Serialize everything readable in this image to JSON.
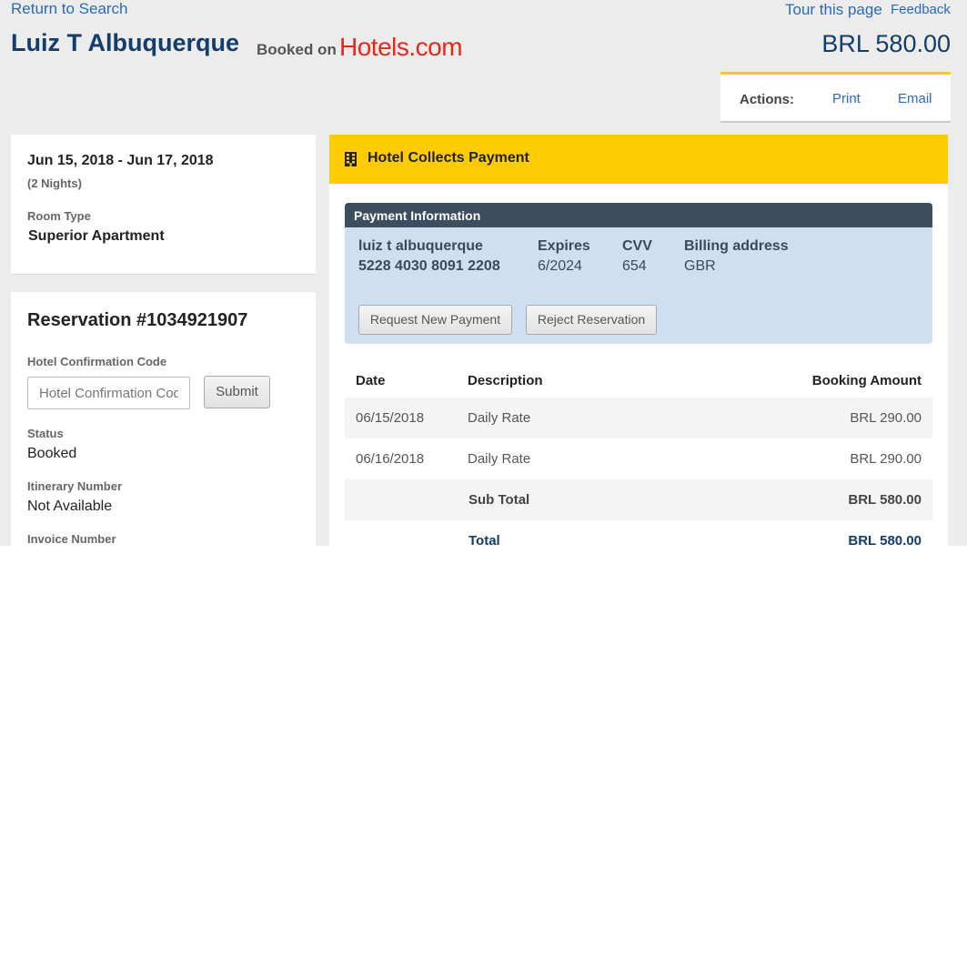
{
  "header": {
    "return_link": "Return to Search",
    "tour_link": "Tour this page",
    "feedback_link": "Feedback",
    "guest_name": "Luiz T Albuquerque",
    "booked_on": "Booked on",
    "brand": "Hotels.com",
    "total_price": "BRL 580.00"
  },
  "actions": {
    "label": "Actions:",
    "print": "Print",
    "email": "Email"
  },
  "stay": {
    "dates": "Jun 15, 2018 - Jun 17, 2018",
    "nights": "(2 Nights)",
    "room_type_label": "Room Type",
    "room_type": "Superior Apartment"
  },
  "reservation": {
    "title": "Reservation #1034921907",
    "conf_code_label": "Hotel Confirmation Code",
    "conf_code_placeholder": "Hotel Confirmation Code",
    "conf_code_value": "",
    "submit_label": "Submit",
    "status_label": "Status",
    "status": "Booked",
    "itinerary_label": "Itinerary Number",
    "itinerary": "Not Available",
    "invoice_label": "Invoice Number"
  },
  "payment_panel": {
    "title": "Hotel Collects Payment",
    "icon": "building-icon",
    "info_title": "Payment Information",
    "cardholder": "luiz t albuquerque",
    "card_number": "5228 4030 8091 2208",
    "expires_label": "Expires",
    "expires": "6/2024",
    "cvv_label": "CVV",
    "cvv": "654",
    "billing_label": "Billing address",
    "billing": "GBR",
    "request_button": "Request New Payment",
    "reject_button": "Reject Reservation"
  },
  "charges": {
    "columns": [
      "Date",
      "Description",
      "Booking Amount"
    ],
    "rows": [
      {
        "date": "06/15/2018",
        "description": "Daily Rate",
        "amount": "BRL 290.00"
      },
      {
        "date": "06/16/2018",
        "description": "Daily Rate",
        "amount": "BRL 290.00"
      }
    ],
    "subtotal_label": "Sub Total",
    "subtotal": "BRL 580.00",
    "total_label": "Total",
    "total": "BRL 580.00"
  },
  "colors": {
    "accent_yellow": "#ffcb05",
    "navy": "#143d6b",
    "link_blue": "#2a6ab8",
    "brand_red": "#e8271b",
    "payment_bg": "#cddff1",
    "payment_header": "#3b4d5e"
  }
}
